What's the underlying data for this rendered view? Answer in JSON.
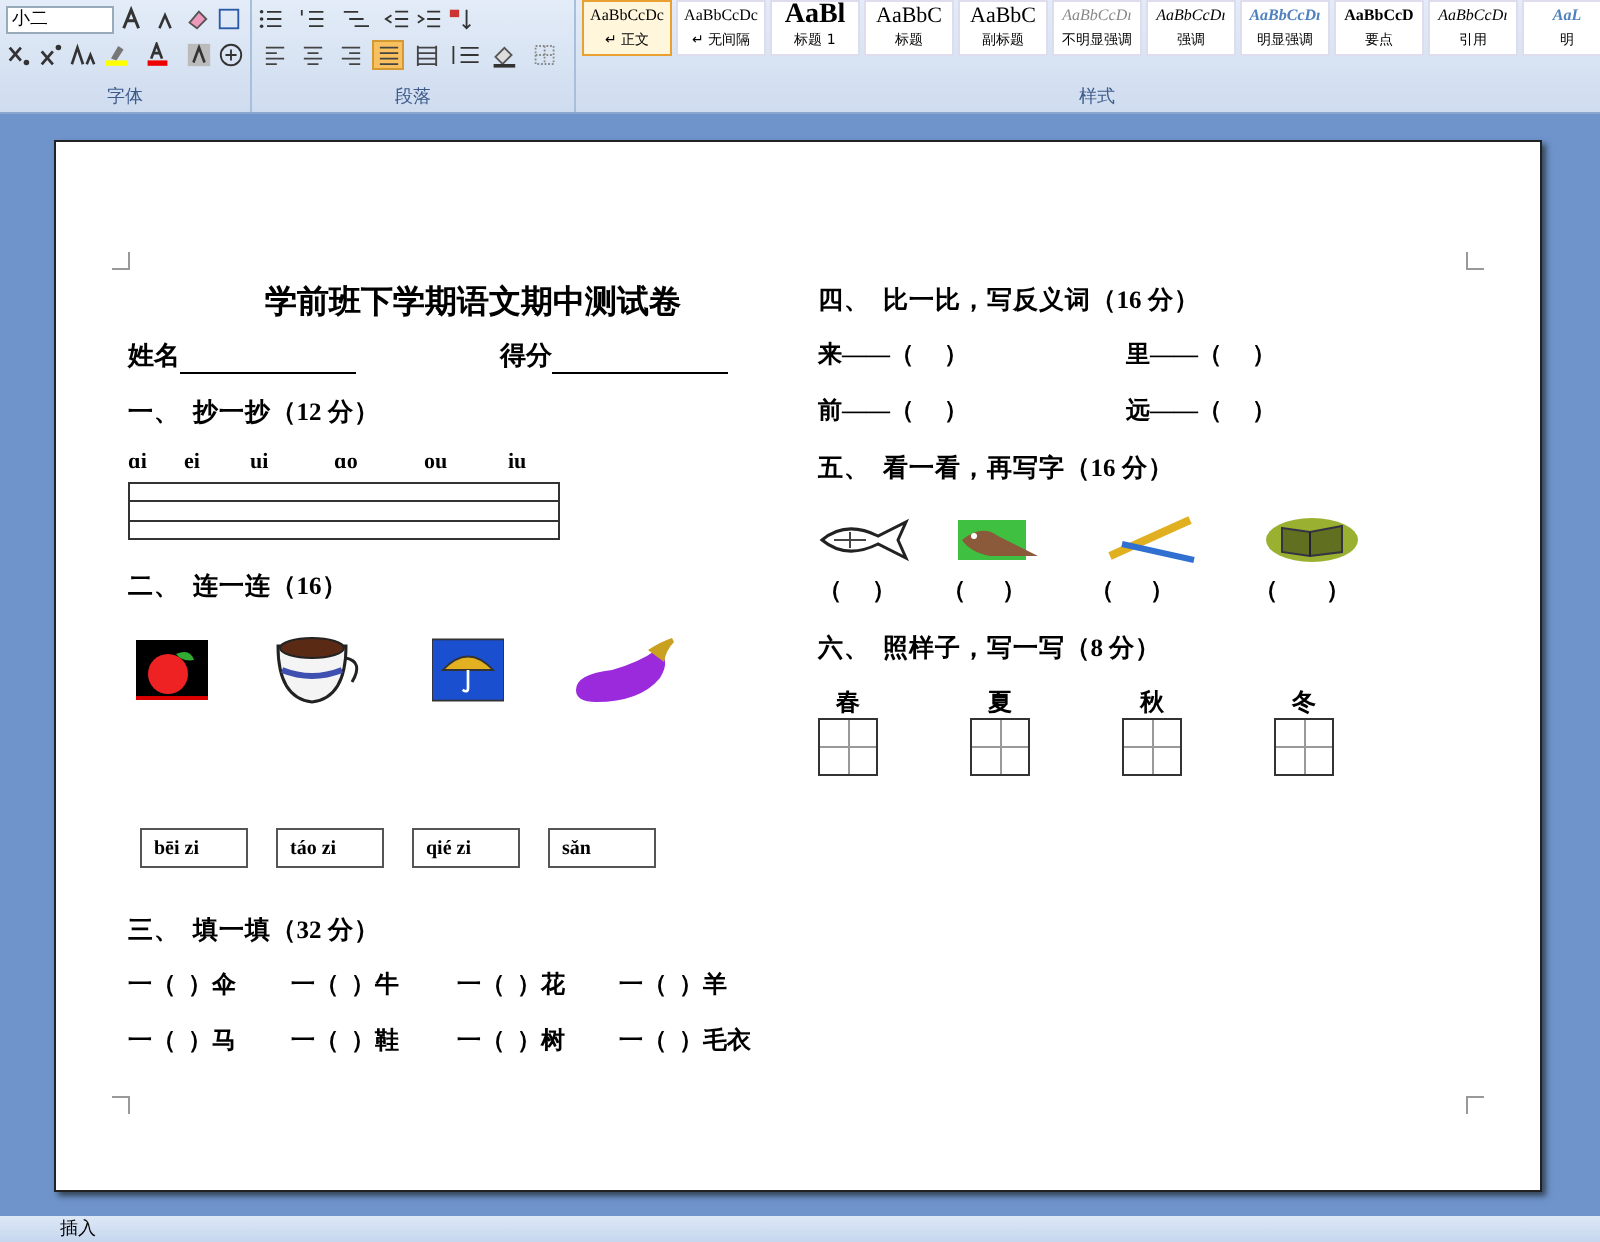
{
  "ribbon": {
    "font_group": {
      "font_size": "小二",
      "label": "字体"
    },
    "paragraph_group": {
      "label": "段落",
      "align_buttons": [
        {
          "kind": "left",
          "selected": false
        },
        {
          "kind": "center",
          "selected": false
        },
        {
          "kind": "right",
          "selected": false
        },
        {
          "kind": "justify",
          "selected": true
        },
        {
          "kind": "distribute",
          "selected": false
        }
      ]
    },
    "styles_group": {
      "label": "样式",
      "items": [
        {
          "preview": "AaBbCcDc",
          "name": "↵ 正文",
          "kind": "normal",
          "selected": true
        },
        {
          "preview": "AaBbCcDc",
          "name": "↵ 无间隔",
          "kind": "normal",
          "selected": false
        },
        {
          "preview": "AaBl",
          "name": "标题 1",
          "kind": "heading-large",
          "selected": false
        },
        {
          "preview": "AaBbC",
          "name": "标题",
          "kind": "heading",
          "selected": false
        },
        {
          "preview": "AaBbC",
          "name": "副标题",
          "kind": "heading",
          "selected": false
        },
        {
          "preview": "AaBbCcDı",
          "name": "不明显强调",
          "kind": "subtle",
          "selected": false
        },
        {
          "preview": "AaBbCcDı",
          "name": "强调",
          "kind": "emphasis",
          "selected": false
        },
        {
          "preview": "AaBbCcDı",
          "name": "明显强调",
          "kind": "intense",
          "selected": false
        },
        {
          "preview": "AaBbCcD",
          "name": "要点",
          "kind": "strong",
          "selected": false
        },
        {
          "preview": "AaBbCcDı",
          "name": "引用",
          "kind": "emphasis",
          "selected": false
        },
        {
          "preview": "AaL",
          "name": "明",
          "kind": "intense",
          "selected": false
        }
      ]
    }
  },
  "document": {
    "title": "学前班下学期语文期中测试卷",
    "fields": [
      {
        "label": "姓名"
      },
      {
        "label": "得分"
      }
    ],
    "left_sections": [
      {
        "kind": "copy",
        "heading": "一、  抄一抄（12 分）",
        "pinyin": [
          "ɑi",
          "ei",
          "ui",
          "ɑo",
          "ou",
          "iu"
        ]
      },
      {
        "kind": "match",
        "heading": "二、  连一连（16）",
        "pictures": [
          {
            "kind": "apple"
          },
          {
            "kind": "cup"
          },
          {
            "kind": "umbrella"
          },
          {
            "kind": "eggplant"
          }
        ],
        "boxes": [
          "bēi zi",
          "táo zi",
          "qié zi",
          "sǎn"
        ]
      },
      {
        "kind": "fill",
        "heading": "三、  填一填（32 分）",
        "rows": [
          [
            "一（  ）伞",
            "一（  ）牛",
            "一（  ）花",
            "一（  ）羊"
          ],
          [
            "一（  ）马",
            "一（  ）鞋",
            "一（  ）树",
            "一（  ）毛衣"
          ]
        ]
      }
    ],
    "right_sections": [
      {
        "kind": "pairs",
        "heading": "四、  比一比，写反义词（16 分）",
        "rows": [
          [
            "来——（     ）",
            "里——（     ）"
          ],
          [
            "前——（     ）",
            "远——（     ）"
          ]
        ]
      },
      {
        "kind": "look",
        "heading": "五、  看一看，再写字（16 分）",
        "pictures": [
          {
            "kind": "fish"
          },
          {
            "kind": "bird"
          },
          {
            "kind": "pens"
          },
          {
            "kind": "book"
          }
        ],
        "blanks": [
          "（     ）",
          "（      ）",
          "（      ）",
          "（        ）"
        ]
      },
      {
        "kind": "grid",
        "heading": "六、  照样子，写一写（8 分）",
        "chars": [
          "春",
          "夏",
          "秋",
          "冬"
        ]
      }
    ]
  },
  "status_bar": {
    "mode": "插入"
  }
}
